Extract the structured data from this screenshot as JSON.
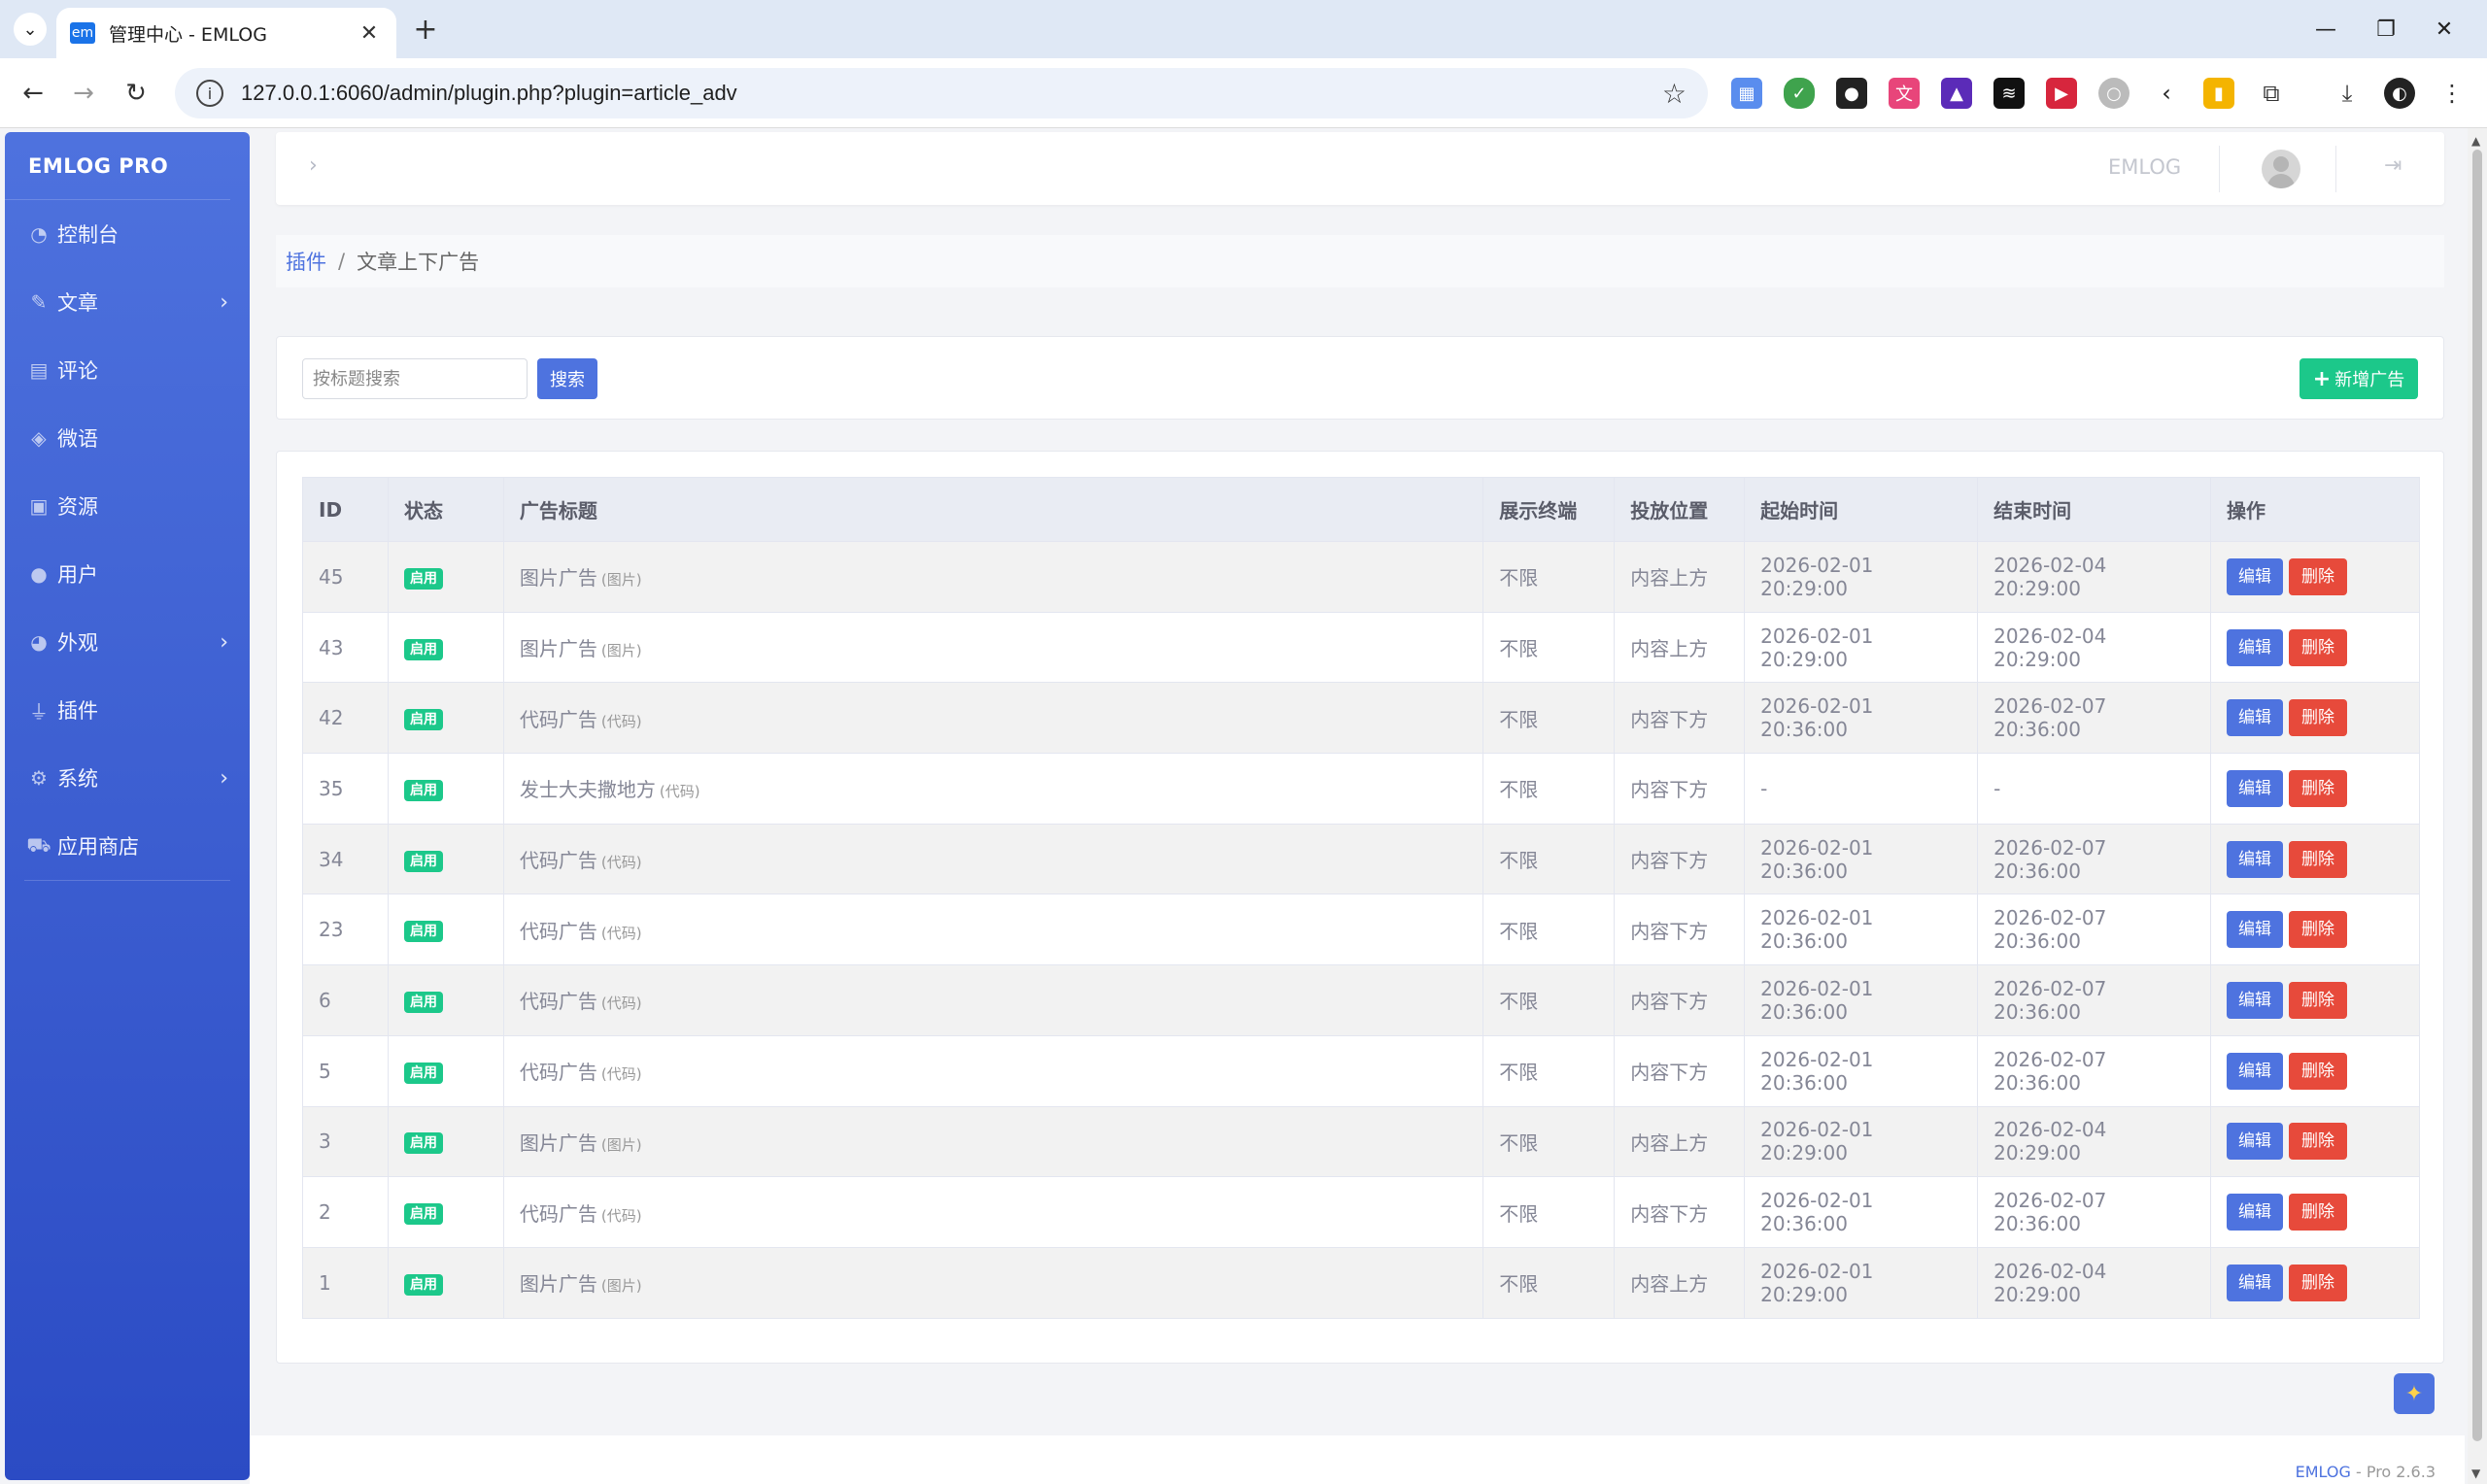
{
  "browser": {
    "tab_title": "管理中心 - EMLOG",
    "favicon_text": "em",
    "url": "127.0.0.1:6060/admin/plugin.php?plugin=article_adv"
  },
  "sidebar": {
    "brand": "EMLOG PRO",
    "items": [
      {
        "label": "控制台",
        "icon": "dashboard-icon",
        "has_submenu": false
      },
      {
        "label": "文章",
        "icon": "pencil-icon",
        "has_submenu": true
      },
      {
        "label": "评论",
        "icon": "comment-icon",
        "has_submenu": false
      },
      {
        "label": "微语",
        "icon": "chat-icon",
        "has_submenu": false
      },
      {
        "label": "资源",
        "icon": "image-icon",
        "has_submenu": false
      },
      {
        "label": "用户",
        "icon": "user-icon",
        "has_submenu": false
      },
      {
        "label": "外观",
        "icon": "palette-icon",
        "has_submenu": true
      },
      {
        "label": "插件",
        "icon": "plug-icon",
        "has_submenu": false
      },
      {
        "label": "系统",
        "icon": "gear-icon",
        "has_submenu": true
      },
      {
        "label": "应用商店",
        "icon": "cart-icon",
        "has_submenu": false
      }
    ]
  },
  "topbar": {
    "brand": "EMLOG"
  },
  "breadcrumb": {
    "parent": "插件",
    "separator": "/",
    "current": "文章上下广告"
  },
  "search": {
    "placeholder": "按标题搜索",
    "button_label": "搜索",
    "add_label": "新增广告"
  },
  "table": {
    "headers": [
      "ID",
      "状态",
      "广告标题",
      "展示终端",
      "投放位置",
      "起始时间",
      "结束时间",
      "操作"
    ],
    "edit_label": "编辑",
    "delete_label": "删除",
    "rows": [
      {
        "id": "45",
        "status": "启用",
        "title": "图片广告",
        "type": "(图片)",
        "terminal": "不限",
        "position": "内容上方",
        "start": "2026-02-01 20:29:00",
        "end": "2026-02-04 20:29:00"
      },
      {
        "id": "43",
        "status": "启用",
        "title": "图片广告",
        "type": "(图片)",
        "terminal": "不限",
        "position": "内容上方",
        "start": "2026-02-01 20:29:00",
        "end": "2026-02-04 20:29:00"
      },
      {
        "id": "42",
        "status": "启用",
        "title": "代码广告",
        "type": "(代码)",
        "terminal": "不限",
        "position": "内容下方",
        "start": "2026-02-01 20:36:00",
        "end": "2026-02-07 20:36:00"
      },
      {
        "id": "35",
        "status": "启用",
        "title": "发士大夫撒地方",
        "type": "(代码)",
        "terminal": "不限",
        "position": "内容下方",
        "start": "-",
        "end": "-"
      },
      {
        "id": "34",
        "status": "启用",
        "title": "代码广告",
        "type": "(代码)",
        "terminal": "不限",
        "position": "内容下方",
        "start": "2026-02-01 20:36:00",
        "end": "2026-02-07 20:36:00"
      },
      {
        "id": "23",
        "status": "启用",
        "title": "代码广告",
        "type": "(代码)",
        "terminal": "不限",
        "position": "内容下方",
        "start": "2026-02-01 20:36:00",
        "end": "2026-02-07 20:36:00"
      },
      {
        "id": "6",
        "status": "启用",
        "title": "代码广告",
        "type": "(代码)",
        "terminal": "不限",
        "position": "内容下方",
        "start": "2026-02-01 20:36:00",
        "end": "2026-02-07 20:36:00"
      },
      {
        "id": "5",
        "status": "启用",
        "title": "代码广告",
        "type": "(代码)",
        "terminal": "不限",
        "position": "内容下方",
        "start": "2026-02-01 20:36:00",
        "end": "2026-02-07 20:36:00"
      },
      {
        "id": "3",
        "status": "启用",
        "title": "图片广告",
        "type": "(图片)",
        "terminal": "不限",
        "position": "内容上方",
        "start": "2026-02-01 20:29:00",
        "end": "2026-02-04 20:29:00"
      },
      {
        "id": "2",
        "status": "启用",
        "title": "代码广告",
        "type": "(代码)",
        "terminal": "不限",
        "position": "内容下方",
        "start": "2026-02-01 20:36:00",
        "end": "2026-02-07 20:36:00"
      },
      {
        "id": "1",
        "status": "启用",
        "title": "图片广告",
        "type": "(图片)",
        "terminal": "不限",
        "position": "内容上方",
        "start": "2026-02-01 20:29:00",
        "end": "2026-02-04 20:29:00"
      }
    ]
  },
  "footer": {
    "link": "EMLOG",
    "version": " - Pro 2.6.3"
  },
  "colors": {
    "primary": "#4e73df",
    "success": "#1cc88a",
    "danger": "#e74a3b",
    "sidebar_top": "#4e72de",
    "sidebar_bottom": "#2b4bc4"
  }
}
